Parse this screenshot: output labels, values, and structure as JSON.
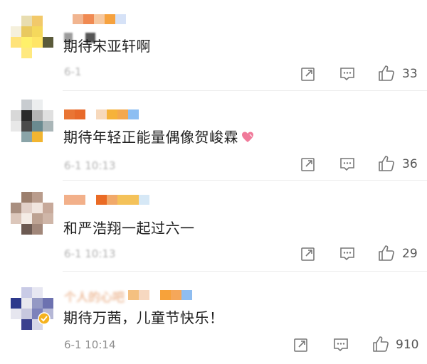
{
  "comments": [
    {
      "avatar_colors": [
        "#ffffff",
        "#e8ddb0",
        "#f2c96a",
        "#ffffff",
        "#f5f0dc",
        "#e9c95f",
        "#f5d85c",
        "#ffffff",
        "#ffe37a",
        "#fff06a",
        "#ffe566",
        "#5a5a3a",
        "#ffffff",
        "#ffe980",
        "#ffffff",
        "#ffffff"
      ],
      "name_colors": [
        "#f1b590",
        "#f08a52",
        "#f6c8a0",
        "#f6a23f",
        "#d6e2f7"
      ],
      "name_blur_prefix_colors": [
        "#9b9b9b",
        "#555555"
      ],
      "text": "期待宋亚轩啊",
      "time": "6-1",
      "time_clear": false,
      "likes": "33"
    },
    {
      "avatar_colors": [
        "#ffffff",
        "#c8ccd0",
        "#eceeef",
        "#ffffff",
        "#d8d8d8",
        "#2a2a2a",
        "#b4b4b4",
        "#e0e0e0",
        "#e8e8e8",
        "#4a4a4a",
        "#6a8a90",
        "#aab6b8",
        "#ffffff",
        "#8aa4a8",
        "#f2b530",
        "#ffffff"
      ],
      "name_colors": [
        "#e97534",
        "#e86a2a",
        "#ffffff",
        "#f7d9bc",
        "#f6b23a",
        "#f4a84d",
        "#8cbef2"
      ],
      "text": "期待年轻正能量偶像贺峻霖",
      "time": "6-1 10:13",
      "time_clear": false,
      "likes": "36"
    },
    {
      "avatar_colors": [
        "#ffffff",
        "#9c7f6d",
        "#b99c8c",
        "#ffffff",
        "#a98f80",
        "#e2d0c8",
        "#f1e5de",
        "#c7a99a",
        "#dcc7bb",
        "#f4ece6",
        "#bda292",
        "#cfb6a8",
        "#ffffff",
        "#6c5a52",
        "#a1877a",
        "#ffffff"
      ],
      "name_colors": [
        "#f2b08a",
        "#f2b08a",
        "#ffffff",
        "#ea6b25",
        "#f1a96a",
        "#f4c25a",
        "#f4c25a",
        "#d6e8f6"
      ],
      "text": "和严浩翔一起过六一",
      "time": "6-1 10:13",
      "time_clear": false,
      "likes": "29"
    },
    {
      "avatar_colors": [
        "#ffffff",
        "#c9cbe6",
        "#e7e7f2",
        "#ffffff",
        "#2d3a8c",
        "#e8e8ee",
        "#9499c4",
        "#6d72b0",
        "#e6e6ef",
        "#c7c8de",
        "#7d82bb",
        "#b5b7d6",
        "#ffffff",
        "#3b418e",
        "#d6d7e8",
        "#ffffff"
      ],
      "name_blur_text": "个人的心吧",
      "name_colors": [
        "#f4c080",
        "#f6d8c0",
        "#ffffff",
        "#f7a23a",
        "#f5a75a",
        "#8fbdf0"
      ],
      "verified_badge": true,
      "text": "期待万茜，儿童节快乐！",
      "time": "6-1 10:14",
      "time_clear": true,
      "likes": "910"
    }
  ],
  "icons": {
    "share": "share-icon",
    "reply": "comment-icon",
    "like": "thumbs-up-icon",
    "heart": "heart-emoji-icon",
    "verified": "verified-badge-icon"
  }
}
